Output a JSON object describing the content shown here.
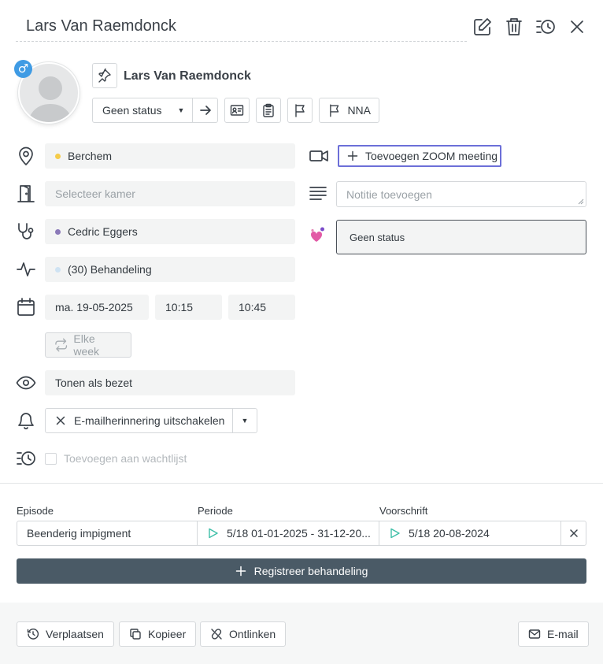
{
  "header": {
    "title": "Lars Van Raemdonck"
  },
  "patient": {
    "name": "Lars Van Raemdonck",
    "gender_symbol": "♂",
    "status_select": "Geen status",
    "flag_label": "NNA"
  },
  "fields": {
    "location": "Berchem",
    "room_placeholder": "Selecteer kamer",
    "therapist": "Cedric Eggers",
    "treatment": "(30) Behandeling",
    "date": "ma. 19-05-2025",
    "start_time": "10:15",
    "end_time": "10:45",
    "repeat": "Elke week",
    "visibility": "Tonen als bezet",
    "reminder": "E-mailherinnering uitschakelen",
    "waitlist": "Toevoegen aan wachtlijst"
  },
  "right": {
    "zoom": "Toevoegen ZOOM meeting",
    "note_placeholder": "Notitie toevoegen",
    "status": "Geen status"
  },
  "episode": {
    "label_episode": "Episode",
    "label_period": "Periode",
    "label_prescription": "Voorschrift",
    "episode_value": "Beenderig impigment",
    "period_value": "5/18 01-01-2025 - 31-12-20...",
    "prescription_value": "5/18 20-08-2024"
  },
  "register_label": "Registreer behandeling",
  "footer": {
    "move": "Verplaatsen",
    "copy": "Kopieer",
    "unlink": "Ontlinken",
    "email": "E-mail"
  },
  "colors": {
    "location_dot": "#f5cc4a",
    "therapist_dot": "#8a79b8",
    "treatment_dot": "#cfe3f3",
    "gender_badge": "#3f9be4",
    "register_bg": "#4a5a66",
    "zoom_border": "#6c6fd8",
    "play_icon": "#3fbfa8"
  }
}
